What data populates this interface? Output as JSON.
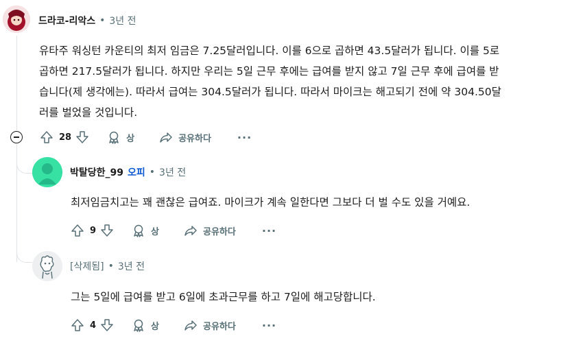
{
  "comments": [
    {
      "author": "드라코-리악스",
      "time": "3년 전",
      "body_lines": [
        "유타주 워싱턴 카운티의 최저 임금은 7.25달러입니다. 이를 6으로 곱하면 43.5달러가 됩니다. 이를 5로",
        "곱하면 217.5달러가 됩니다. 하지만 우리는 5일 근무 후에는 급여를 받지 않고 7일 근무 후에 급여를 받",
        "습니다(제 생각에는). 따라서 급여는 304.5달러가 됩니다. 따라서 마이크는 해고되기 전에 약 304.50달",
        "러를 벌었을 것입니다."
      ],
      "votes": "28",
      "award_label": "상",
      "share_label": "공유하다",
      "more": "···"
    },
    {
      "author": "박탈당한_99",
      "badge": "오피",
      "time": "3년 전",
      "body": "최저임금치고는 꽤 괜찮은 급여죠. 마이크가 계속 일한다면 그보다 더 벌 수도 있을 거예요.",
      "votes": "9",
      "award_label": "상",
      "share_label": "공유하다",
      "more": "···"
    },
    {
      "author": "[삭제됨]",
      "time": "3년 전",
      "body": "그는 5일에 급여를 받고 6일에 초과근무를 하고 7일에 해고당합니다.",
      "votes": "4",
      "award_label": "상",
      "share_label": "공유하다",
      "more": "···"
    }
  ],
  "colors": {
    "meta": "#576f76",
    "op_badge": "#0a56d0",
    "avatar2": "#37e0a3",
    "thread_line": "#e0e3e5"
  },
  "icons": [
    "upvote-icon",
    "downvote-icon",
    "award-icon",
    "share-icon",
    "collapse-icon"
  ]
}
